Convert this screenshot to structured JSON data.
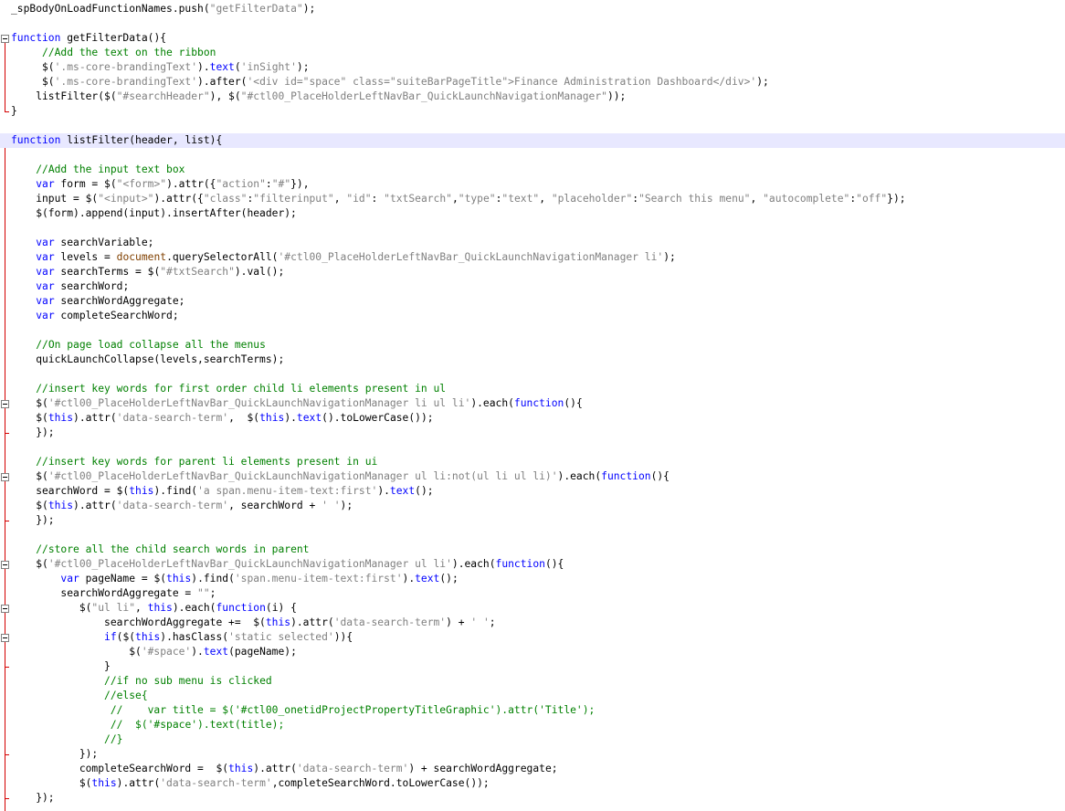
{
  "editor": {
    "colors": {
      "keyword": "#0000ff",
      "string": "#808080",
      "comment": "#008000",
      "operator": "#000080",
      "object": "#804000",
      "current_line": "#e8e8ff",
      "fold_guide": "#d40000"
    },
    "current_line": 9,
    "lines": [
      [
        [
          "p",
          "_spBodyOnLoadFunctionNames.push("
        ],
        [
          "s",
          "\"getFilterData\""
        ],
        [
          "p",
          ");"
        ]
      ],
      [],
      [
        [
          "k",
          "function"
        ],
        [
          "p",
          " getFilterData(){"
        ]
      ],
      [
        [
          "p",
          "     "
        ],
        [
          "c",
          "//Add the text on the ribbon"
        ]
      ],
      [
        [
          "p",
          "     $("
        ],
        [
          "s",
          "'.ms-core-brandingText'"
        ],
        [
          "p",
          ")."
        ],
        [
          "k",
          "text"
        ],
        [
          "p",
          "("
        ],
        [
          "s",
          "'inSight'"
        ],
        [
          "p",
          ");"
        ]
      ],
      [
        [
          "p",
          "     $("
        ],
        [
          "s",
          "'.ms-core-brandingText'"
        ],
        [
          "p",
          ").after("
        ],
        [
          "s",
          "'<div id=\"space\" class=\"suiteBarPageTitle\">Finance Administration Dashboard</div>'"
        ],
        [
          "p",
          ");"
        ]
      ],
      [
        [
          "p",
          "    listFilter($("
        ],
        [
          "s",
          "\"#searchHeader\""
        ],
        [
          "p",
          "), $("
        ],
        [
          "s",
          "\"#ctl00_PlaceHolderLeftNavBar_QuickLaunchNavigationManager\""
        ],
        [
          "p",
          "));"
        ]
      ],
      [
        [
          "p",
          "}"
        ]
      ],
      [],
      [
        [
          "k",
          "function"
        ],
        [
          "p",
          " listFilter(header, list){"
        ]
      ],
      [],
      [
        [
          "p",
          "    "
        ],
        [
          "c",
          "//Add the input text box"
        ]
      ],
      [
        [
          "p",
          "    "
        ],
        [
          "k",
          "var"
        ],
        [
          "p",
          " form = $("
        ],
        [
          "s",
          "\"<form>\""
        ],
        [
          "p",
          ").attr({"
        ],
        [
          "s",
          "\"action\""
        ],
        [
          "p",
          ":"
        ],
        [
          "s",
          "\"#\""
        ],
        [
          "p",
          "}),"
        ]
      ],
      [
        [
          "p",
          "    input = $("
        ],
        [
          "s",
          "\"<input>\""
        ],
        [
          "p",
          ").attr({"
        ],
        [
          "s",
          "\"class\""
        ],
        [
          "p",
          ":"
        ],
        [
          "s",
          "\"filterinput\""
        ],
        [
          "p",
          ", "
        ],
        [
          "s",
          "\"id\""
        ],
        [
          "p",
          ": "
        ],
        [
          "s",
          "\"txtSearch\""
        ],
        [
          "p",
          ","
        ],
        [
          "s",
          "\"type\""
        ],
        [
          "p",
          ":"
        ],
        [
          "s",
          "\"text\""
        ],
        [
          "p",
          ", "
        ],
        [
          "s",
          "\"placeholder\""
        ],
        [
          "p",
          ":"
        ],
        [
          "s",
          "\"Search this menu\""
        ],
        [
          "p",
          ", "
        ],
        [
          "s",
          "\"autocomplete\""
        ],
        [
          "p",
          ":"
        ],
        [
          "s",
          "\"off\""
        ],
        [
          "p",
          "});"
        ]
      ],
      [
        [
          "p",
          "    $(form).append(input).insertAfter(header);"
        ]
      ],
      [],
      [
        [
          "p",
          "    "
        ],
        [
          "k",
          "var"
        ],
        [
          "p",
          " searchVariable;"
        ]
      ],
      [
        [
          "p",
          "    "
        ],
        [
          "k",
          "var"
        ],
        [
          "p",
          " levels = "
        ],
        [
          "o",
          "document"
        ],
        [
          "p",
          ".querySelectorAll("
        ],
        [
          "s",
          "'#ctl00_PlaceHolderLeftNavBar_QuickLaunchNavigationManager li'"
        ],
        [
          "p",
          ");"
        ]
      ],
      [
        [
          "p",
          "    "
        ],
        [
          "k",
          "var"
        ],
        [
          "p",
          " searchTerms = $("
        ],
        [
          "s",
          "\"#txtSearch\""
        ],
        [
          "p",
          ").val();"
        ]
      ],
      [
        [
          "p",
          "    "
        ],
        [
          "k",
          "var"
        ],
        [
          "p",
          " searchWord;"
        ]
      ],
      [
        [
          "p",
          "    "
        ],
        [
          "k",
          "var"
        ],
        [
          "p",
          " searchWordAggregate;"
        ]
      ],
      [
        [
          "p",
          "    "
        ],
        [
          "k",
          "var"
        ],
        [
          "p",
          " completeSearchWord;"
        ]
      ],
      [],
      [
        [
          "p",
          "    "
        ],
        [
          "c",
          "//On page load collapse all the menus"
        ]
      ],
      [
        [
          "p",
          "    quickLaunchCollapse(levels,searchTerms);"
        ]
      ],
      [],
      [
        [
          "p",
          "    "
        ],
        [
          "c",
          "//insert key words for first order child li elements present in ul"
        ]
      ],
      [
        [
          "p",
          "    $("
        ],
        [
          "s",
          "'#ctl00_PlaceHolderLeftNavBar_QuickLaunchNavigationManager li ul li'"
        ],
        [
          "p",
          ").each("
        ],
        [
          "k",
          "function"
        ],
        [
          "p",
          "(){"
        ]
      ],
      [
        [
          "p",
          "    $("
        ],
        [
          "k",
          "this"
        ],
        [
          "p",
          ").attr("
        ],
        [
          "s",
          "'data-search-term'"
        ],
        [
          "p",
          ",  $("
        ],
        [
          "k",
          "this"
        ],
        [
          "p",
          ")."
        ],
        [
          "k",
          "text"
        ],
        [
          "p",
          "().toLowerCase());"
        ]
      ],
      [
        [
          "p",
          "    });"
        ]
      ],
      [],
      [
        [
          "p",
          "    "
        ],
        [
          "c",
          "//insert key words for parent li elements present in ui"
        ]
      ],
      [
        [
          "p",
          "    $("
        ],
        [
          "s",
          "'#ctl00_PlaceHolderLeftNavBar_QuickLaunchNavigationManager ul li:not(ul li ul li)'"
        ],
        [
          "p",
          ").each("
        ],
        [
          "k",
          "function"
        ],
        [
          "p",
          "(){"
        ]
      ],
      [
        [
          "p",
          "    searchWord = $("
        ],
        [
          "k",
          "this"
        ],
        [
          "p",
          ").find("
        ],
        [
          "s",
          "'a span.menu-item-text:first'"
        ],
        [
          "p",
          ")."
        ],
        [
          "k",
          "text"
        ],
        [
          "p",
          "();"
        ]
      ],
      [
        [
          "p",
          "    $("
        ],
        [
          "k",
          "this"
        ],
        [
          "p",
          ").attr("
        ],
        [
          "s",
          "'data-search-term'"
        ],
        [
          "p",
          ", searchWord + "
        ],
        [
          "s",
          "' '"
        ],
        [
          "p",
          ");"
        ]
      ],
      [
        [
          "p",
          "    });"
        ]
      ],
      [],
      [
        [
          "p",
          "    "
        ],
        [
          "c",
          "//store all the child search words in parent"
        ]
      ],
      [
        [
          "p",
          "    $("
        ],
        [
          "s",
          "'#ctl00_PlaceHolderLeftNavBar_QuickLaunchNavigationManager ul li'"
        ],
        [
          "p",
          ").each("
        ],
        [
          "k",
          "function"
        ],
        [
          "p",
          "(){"
        ]
      ],
      [
        [
          "p",
          "        "
        ],
        [
          "k",
          "var"
        ],
        [
          "p",
          " pageName = $("
        ],
        [
          "k",
          "this"
        ],
        [
          "p",
          ").find("
        ],
        [
          "s",
          "'span.menu-item-text:first'"
        ],
        [
          "p",
          ")."
        ],
        [
          "k",
          "text"
        ],
        [
          "p",
          "();"
        ]
      ],
      [
        [
          "p",
          "        searchWordAggregate = "
        ],
        [
          "s",
          "\"\""
        ],
        [
          "p",
          ";"
        ]
      ],
      [
        [
          "p",
          "           $("
        ],
        [
          "s",
          "\"ul li\""
        ],
        [
          "p",
          ", "
        ],
        [
          "k",
          "this"
        ],
        [
          "p",
          ").each("
        ],
        [
          "k",
          "function"
        ],
        [
          "p",
          "(i) {"
        ]
      ],
      [
        [
          "p",
          "               searchWordAggregate +=  $("
        ],
        [
          "k",
          "this"
        ],
        [
          "p",
          ").attr("
        ],
        [
          "s",
          "'data-search-term'"
        ],
        [
          "p",
          ") + "
        ],
        [
          "s",
          "' '"
        ],
        [
          "p",
          ";"
        ]
      ],
      [
        [
          "p",
          "               "
        ],
        [
          "k",
          "if"
        ],
        [
          "p",
          "($("
        ],
        [
          "k",
          "this"
        ],
        [
          "p",
          ").hasClass("
        ],
        [
          "s",
          "'static selected'"
        ],
        [
          "p",
          ")){"
        ]
      ],
      [
        [
          "p",
          "                   $("
        ],
        [
          "s",
          "'#space'"
        ],
        [
          "p",
          ")."
        ],
        [
          "k",
          "text"
        ],
        [
          "p",
          "(pageName);"
        ]
      ],
      [
        [
          "p",
          "               }"
        ]
      ],
      [
        [
          "p",
          "               "
        ],
        [
          "c",
          "//if no sub menu is clicked"
        ]
      ],
      [
        [
          "p",
          "               "
        ],
        [
          "c",
          "//else{"
        ]
      ],
      [
        [
          "p",
          "                "
        ],
        [
          "c",
          "//    var title = $('#ctl00_onetidProjectPropertyTitleGraphic').attr('Title');"
        ]
      ],
      [
        [
          "p",
          "                "
        ],
        [
          "c",
          "//  $('#space').text(title);"
        ]
      ],
      [
        [
          "p",
          "               "
        ],
        [
          "c",
          "//}"
        ]
      ],
      [
        [
          "p",
          "           });"
        ]
      ],
      [
        [
          "p",
          "           completeSearchWord =  $("
        ],
        [
          "k",
          "this"
        ],
        [
          "p",
          ").attr("
        ],
        [
          "s",
          "'data-search-term'"
        ],
        [
          "p",
          ") + searchWordAggregate;"
        ]
      ],
      [
        [
          "p",
          "           $("
        ],
        [
          "k",
          "this"
        ],
        [
          "p",
          ").attr("
        ],
        [
          "s",
          "'data-search-term'"
        ],
        [
          "p",
          ",completeSearchWord.toLowerCase());"
        ]
      ],
      [
        [
          "p",
          "    });"
        ]
      ]
    ]
  }
}
